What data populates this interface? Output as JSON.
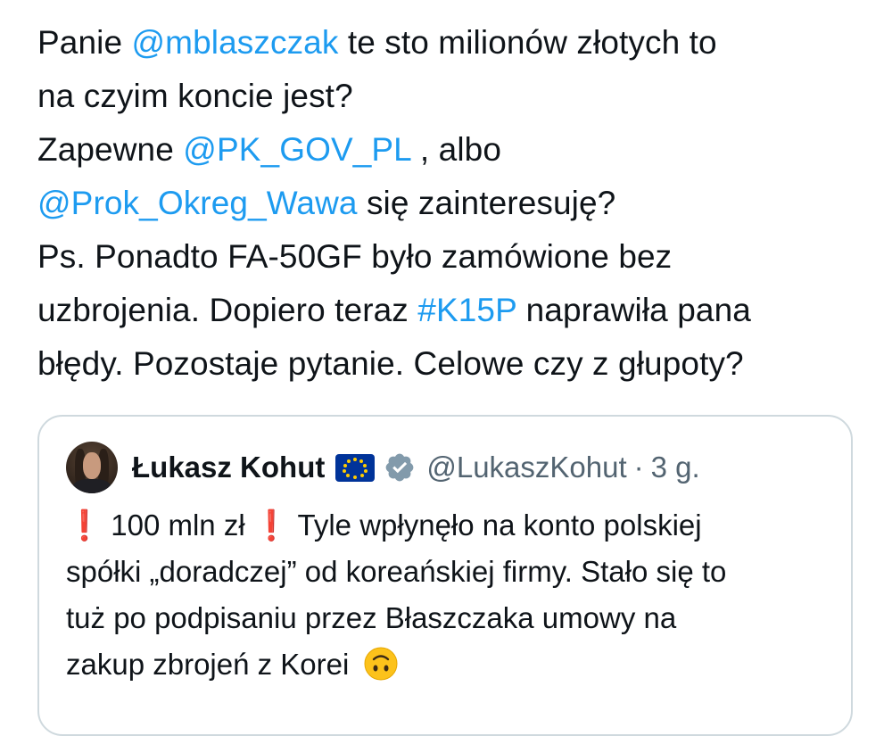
{
  "tweet": {
    "line1": {
      "t1": "Panie ",
      "mention": "@mblaszczak",
      "t2": " te sto milionów złotych to"
    },
    "line2": {
      "t1": "na czyim koncie jest?"
    },
    "line3": {
      "t1": "Zapewne ",
      "mention": "@PK_GOV_PL",
      "t2": " , albo"
    },
    "line4": {
      "mention": "@Prok_Okreg_Wawa",
      "t2": " się zainteresuję?"
    },
    "line5": {
      "t1": "Ps. Ponadto FA-50GF było zamówione bez"
    },
    "line6": {
      "t1": "uzbrojenia. Dopiero teraz ",
      "hashtag": "#K15P",
      "t2": " naprawiła pana"
    },
    "line7": {
      "t1": "błędy. Pozostaje pytanie. Celowe czy z głupoty?"
    }
  },
  "quote": {
    "author_name": "Łukasz Kohut",
    "handle": "@LukaszKohut",
    "separator": "·",
    "time": "3 g.",
    "text": {
      "exclaim1": "❗",
      "amount": " 100 mln zł ",
      "exclaim2": "❗",
      "rest_line1": " Tyle wpłynęło na konto polskiej",
      "line2": "spółki „doradczej” od koreańskiej firmy. Stało się to",
      "line3": "tuż po podpisaniu przez Błaszczaka umowy na",
      "line4": "zakup zbrojeń z Korei"
    }
  },
  "icons": {
    "flag": "eu-flag-icon",
    "verified": "verified-badge-icon",
    "emoji": "upside-down-face-emoji"
  },
  "colors": {
    "link": "#1d9bf0",
    "secondary_text": "#536471",
    "card_border": "#cfd9de",
    "exclamation": "#e0245e"
  }
}
